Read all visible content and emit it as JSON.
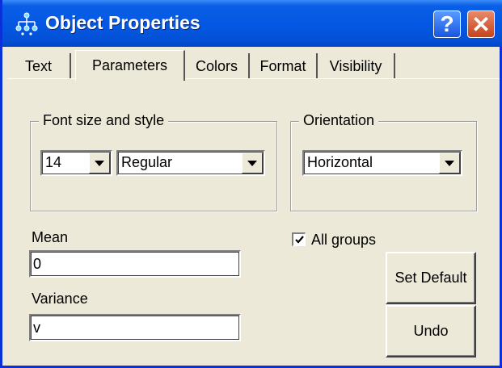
{
  "window": {
    "title": "Object Properties",
    "help_label": "?",
    "close_label": "✕"
  },
  "tabs": [
    {
      "label": "Text"
    },
    {
      "label": "Parameters"
    },
    {
      "label": "Colors"
    },
    {
      "label": "Format"
    },
    {
      "label": "Visibility"
    }
  ],
  "font_group": {
    "label": "Font size and style",
    "size_value": "14",
    "style_value": "Regular"
  },
  "orientation_group": {
    "label": "Orientation",
    "value": "Horizontal"
  },
  "mean": {
    "label": "Mean",
    "value": "0"
  },
  "variance": {
    "label": "Variance",
    "value": "v"
  },
  "all_groups": {
    "label": "All groups",
    "checked": true
  },
  "buttons": {
    "set_default": "Set Default",
    "undo": "Undo"
  }
}
